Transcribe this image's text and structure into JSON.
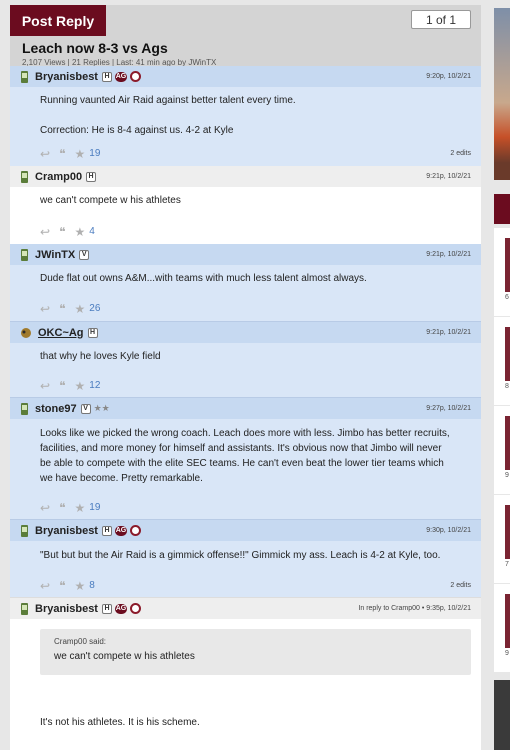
{
  "header": {
    "reply_button": "Post Reply",
    "pager": "1 of 1"
  },
  "thread": {
    "title": "Leach now 8-3 vs Ags",
    "meta": "2,107 Views | 21 Replies | Last: 41 min ago by JWinTX"
  },
  "colors": {
    "brand": "#6b0c1f",
    "post_blue": "#d9e6f7",
    "post_head_blue": "#c6d9f1",
    "count": "#4a7cbf"
  },
  "posts": [
    {
      "user": "Bryanisbest",
      "badges": [
        "H",
        "AG"
      ],
      "time": "9:20p, 10/2/21",
      "lines": [
        "Running vaunted Air Raid against better talent every time.",
        "Correction: He is 8-4 against us. 4-2 at Kyle"
      ],
      "likes": "19",
      "edits": "2 edits"
    },
    {
      "user": "Cramp00",
      "badges": [
        "H"
      ],
      "time": "9:21p, 10/2/21",
      "lines": [
        "we can't compete w his athletes"
      ],
      "likes": "4"
    },
    {
      "user": "JWinTX",
      "badges": [
        "V"
      ],
      "time": "9:21p, 10/2/21",
      "lines": [
        "Dude flat out owns A&M...with teams with much less talent almost always."
      ],
      "likes": "26"
    },
    {
      "user": "OKC~Ag",
      "badges": [
        "H"
      ],
      "time": "9:21p, 10/2/21",
      "lines": [
        "that why he loves Kyle field"
      ],
      "likes": "12"
    },
    {
      "user": "stone97",
      "badges": [
        "V"
      ],
      "stars": "★★",
      "time": "9:27p, 10/2/21",
      "lines": [
        "Looks like we picked the wrong coach. Leach does more with less. Jimbo has better recruits, facilities, and more money for himself and assistants. It's obvious now that Jimbo will never be able to compete with the elite SEC teams. He can't even beat the lower tier teams which we have become. Pretty remarkable."
      ],
      "likes": "19"
    },
    {
      "user": "Bryanisbest",
      "badges": [
        "H",
        "AG"
      ],
      "time": "9:30p, 10/2/21",
      "lines": [
        "\"But but but the Air Raid is a gimmick offense!!\" Gimmick my ass. Leach is 4-2 at Kyle, too."
      ],
      "likes": "8",
      "edits": "2 edits"
    },
    {
      "user": "Bryanisbest",
      "badges": [
        "H",
        "AG"
      ],
      "time": "In reply to Cramp00 • 9:35p, 10/2/21",
      "quote_attr": "Cramp00 said:",
      "quote_text": "we can't compete w his athletes",
      "lines": [
        "It's not his athletes. It is his scheme."
      ]
    }
  ],
  "sidebar": {
    "counts": [
      "6",
      "8",
      "9",
      "7",
      "9"
    ]
  }
}
